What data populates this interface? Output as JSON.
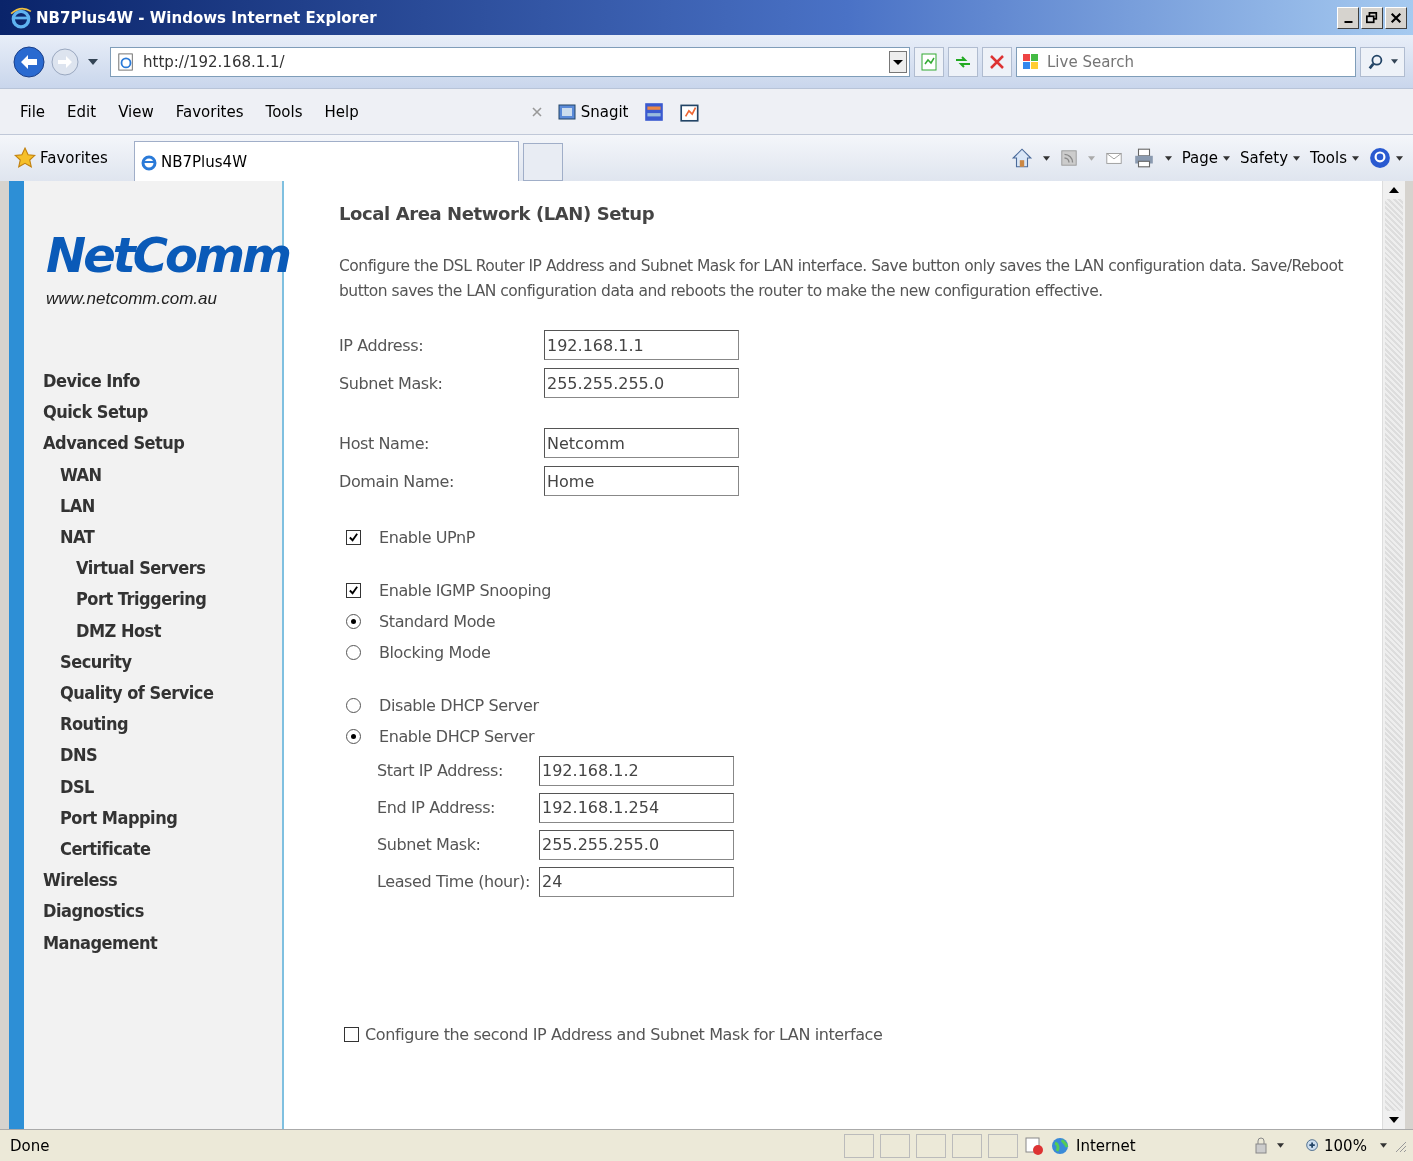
{
  "window": {
    "title": "NB7Plus4W - Windows Internet Explorer"
  },
  "address_bar": {
    "url": "http://192.168.1.1/"
  },
  "search": {
    "placeholder": "Live Search"
  },
  "menu": [
    "File",
    "Edit",
    "View",
    "Favorites",
    "Tools",
    "Help"
  ],
  "toolbar": {
    "snagit": "Snagit"
  },
  "favorites_bar": {
    "favorites": "Favorites",
    "tab": "NB7Plus4W",
    "commands": [
      "Page",
      "Safety",
      "Tools"
    ]
  },
  "sidebar": {
    "logo": "NetComm",
    "logo_url": "www.netcomm.com.au",
    "items": [
      {
        "label": "Device Info"
      },
      {
        "label": "Quick Setup"
      },
      {
        "label": "Advanced Setup",
        "children": [
          {
            "label": "WAN"
          },
          {
            "label": "LAN"
          },
          {
            "label": "NAT",
            "children": [
              {
                "label": "Virtual Servers"
              },
              {
                "label": "Port Triggering"
              },
              {
                "label": "DMZ Host"
              }
            ]
          },
          {
            "label": "Security"
          },
          {
            "label": "Quality of Service"
          },
          {
            "label": "Routing"
          },
          {
            "label": "DNS"
          },
          {
            "label": "DSL"
          },
          {
            "label": "Port Mapping"
          },
          {
            "label": "Certificate"
          }
        ]
      },
      {
        "label": "Wireless"
      },
      {
        "label": "Diagnostics"
      },
      {
        "label": "Management"
      }
    ]
  },
  "content": {
    "title": "Local Area Network (LAN) Setup",
    "description": "Configure the DSL Router IP Address and Subnet Mask for LAN interface.  Save button only saves the LAN configuration data. Save/Reboot button saves the LAN configuration data and reboots the router to make the new configuration effective.",
    "sections": [
      [
        {
          "kind": "field",
          "label": "IP Address:",
          "value": "192.168.1.1"
        },
        {
          "kind": "field",
          "label": "Subnet Mask:",
          "value": "255.255.255.0"
        }
      ],
      [
        {
          "kind": "field",
          "label": "Host Name:",
          "value": "Netcomm"
        },
        {
          "kind": "field",
          "label": "Domain Name:",
          "value": "Home"
        }
      ],
      [
        {
          "kind": "checkbox",
          "label": "Enable UPnP",
          "checked": true
        }
      ],
      [
        {
          "kind": "checkbox",
          "label": "Enable IGMP Snooping",
          "checked": true
        },
        {
          "kind": "radio",
          "label": "Standard Mode",
          "selected": true
        },
        {
          "kind": "radio",
          "label": "Blocking Mode",
          "selected": false
        }
      ],
      [
        {
          "kind": "radio",
          "label": "Disable DHCP Server",
          "selected": false
        },
        {
          "kind": "radio",
          "label": "Enable DHCP Server",
          "selected": true
        },
        {
          "kind": "subfield",
          "label": "Start IP Address:",
          "value": "192.168.1.2"
        },
        {
          "kind": "subfield",
          "label": "End IP Address:",
          "value": "192.168.1.254"
        },
        {
          "kind": "subfield",
          "label": "Subnet Mask:",
          "value": "255.255.255.0"
        },
        {
          "kind": "subfield",
          "label": "Leased Time (hour):",
          "value": "24"
        }
      ]
    ],
    "second_ip": {
      "label": "Configure the second IP Address and Subnet Mask for LAN interface",
      "checked": false
    }
  },
  "status_bar": {
    "text": "Done",
    "zone": "Internet",
    "zoom": "100%"
  }
}
